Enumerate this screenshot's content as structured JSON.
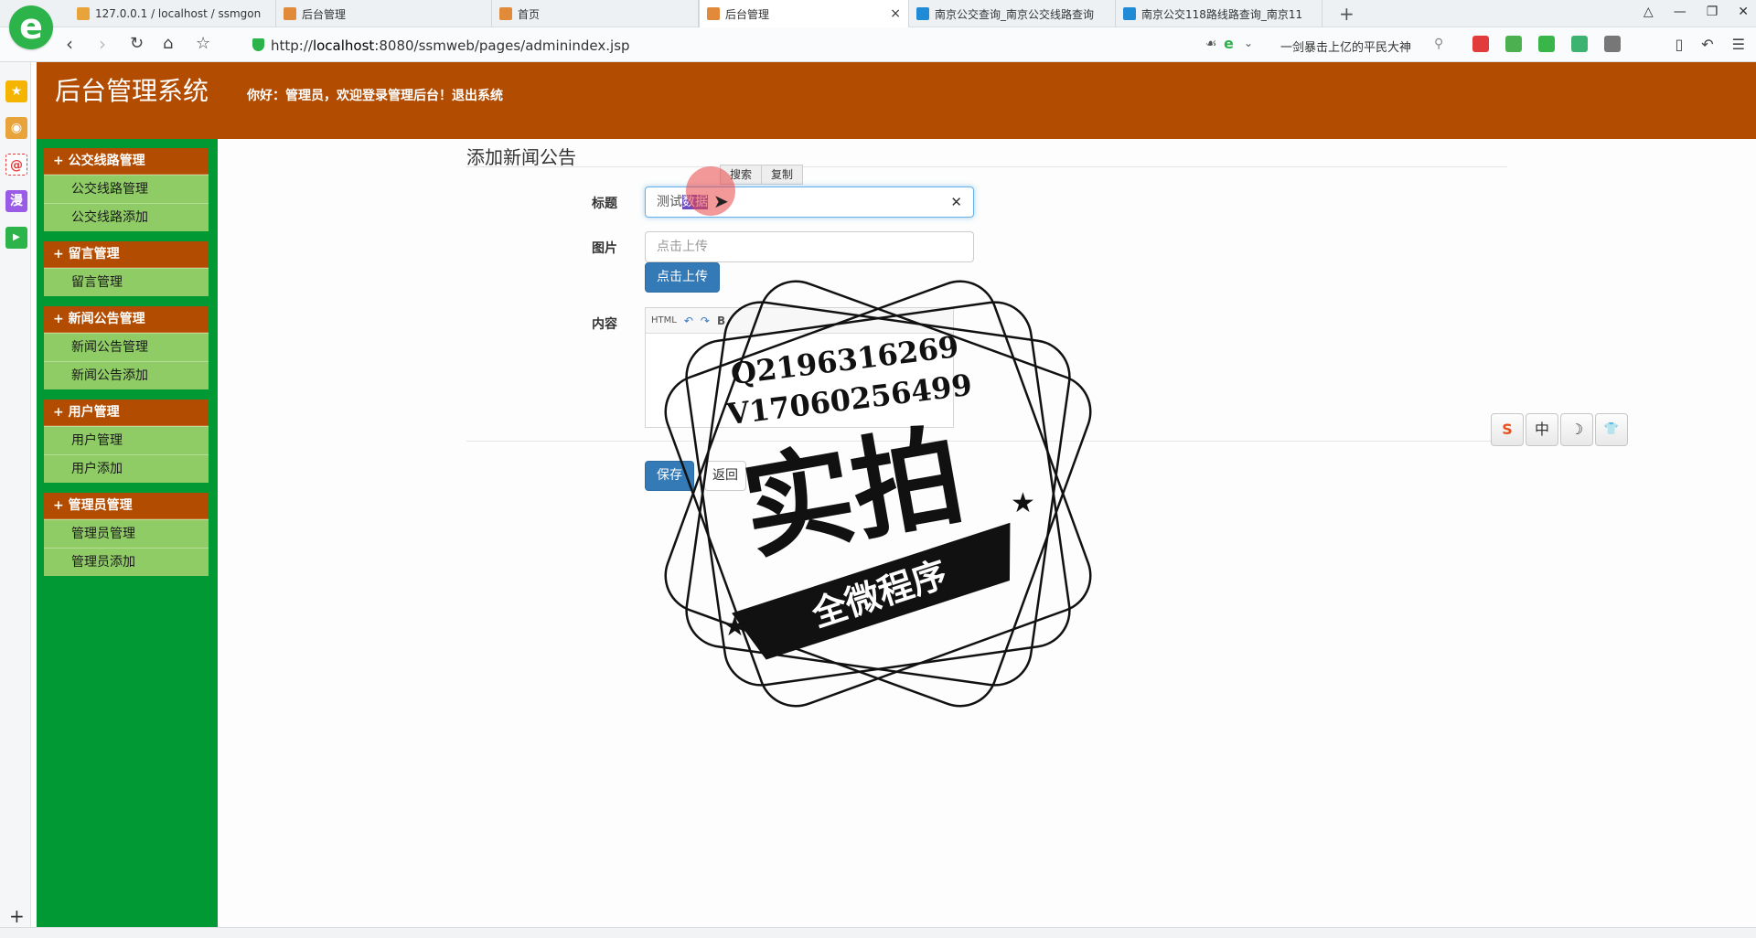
{
  "browser": {
    "tabs": [
      {
        "label": "127.0.0.1 / localhost / ssmgon",
        "favicon_color": "#e8a33a"
      },
      {
        "label": "后台管理",
        "favicon_color": "#e08a3a"
      },
      {
        "label": "首页",
        "favicon_color": "#e08a3a"
      },
      {
        "label": "后台管理",
        "favicon_color": "#e08a3a",
        "active": true
      },
      {
        "label": "南京公交查询_南京公交线路查询",
        "favicon_color": "#1f8ad6"
      },
      {
        "label": "南京公交118路线路查询_南京11",
        "favicon_color": "#1f8ad6"
      }
    ],
    "tab_close_glyph": "×",
    "new_tab_glyph": "+",
    "address": {
      "scheme": "http://",
      "host": "localhost",
      "rest": ":8080/ssmweb/pages/adminindex.jsp"
    },
    "search_hint": "一剑暴击上亿的平民大神",
    "logo_glyph": "e"
  },
  "app": {
    "title": "后台管理系统",
    "greeting": "你好：管理员，欢迎登录管理后台！",
    "logout_label": "退出系统"
  },
  "sidebar": {
    "groups": [
      {
        "title": "+ 公交线路管理",
        "items": [
          "公交线路管理",
          "公交线路添加"
        ]
      },
      {
        "title": "+ 留言管理",
        "items": [
          "留言管理"
        ]
      },
      {
        "title": "+ 新闻公告管理",
        "items": [
          "新闻公告管理",
          "新闻公告添加"
        ]
      },
      {
        "title": "+ 用户管理",
        "items": [
          "用户管理",
          "用户添加"
        ]
      },
      {
        "title": "+ 管理员管理",
        "items": [
          "管理员管理",
          "管理员添加"
        ]
      }
    ]
  },
  "form": {
    "page_title": "添加新闻公告",
    "context_menu": {
      "search_label": "搜索",
      "copy_label": "复制"
    },
    "title_label": "标题",
    "title_value_plain": "测试",
    "title_value_selected": "数据",
    "image_label": "图片",
    "image_placeholder": "点击上传",
    "upload_button": "点击上传",
    "content_label": "内容",
    "editor_toolbar": {
      "html_label": "HTML",
      "bold_label": "B"
    },
    "save_button": "保存",
    "back_button": "返回"
  },
  "ime": {
    "buttons": [
      "S",
      "中",
      "☽",
      "👕"
    ]
  },
  "watermark": {
    "line1": "Q2196316269",
    "line2": "V17060256499",
    "main": "实拍",
    "banner": "全微程序"
  }
}
